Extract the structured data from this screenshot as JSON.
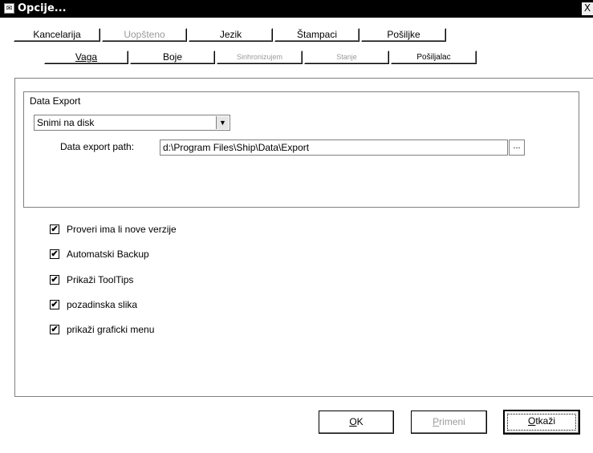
{
  "window": {
    "title": "Opcije...",
    "close_glyph": "X",
    "app_icon": "app-icon"
  },
  "tabs_row1": [
    {
      "label": "Kancelarija",
      "enabled": true
    },
    {
      "label": "Uopšteno",
      "enabled": false
    },
    {
      "label": "Jezik",
      "enabled": true
    },
    {
      "label": "Štampaci",
      "enabled": true
    },
    {
      "label": "Pošiljke",
      "enabled": true
    }
  ],
  "tabs_row2": [
    {
      "label": "Vaga",
      "enabled": true
    },
    {
      "label": "Boje",
      "enabled": true
    },
    {
      "label": "Sinhronizujem",
      "enabled": false
    },
    {
      "label": "Stanje",
      "enabled": false
    },
    {
      "label": "Pošiljalac",
      "enabled": true
    }
  ],
  "data_export": {
    "group_title": "Data Export",
    "mode_selected": "Snimi na disk",
    "path_label": "Data export path:",
    "path_value": "d:\\Program Files\\Ship\\Data\\Export",
    "browse_label": "..."
  },
  "options": [
    {
      "label": "Proveri ima li nove verzije",
      "checked": true
    },
    {
      "label": "Automatski Backup",
      "checked": true
    },
    {
      "label": "Prikaži ToolTips",
      "checked": true
    },
    {
      "label": "pozadinska slika",
      "checked": true
    },
    {
      "label": "prikaži graficki menu",
      "checked": true
    }
  ],
  "buttons": {
    "ok": {
      "mnemonic": "O",
      "rest": "K",
      "enabled": true
    },
    "apply": {
      "mnemonic": "P",
      "rest": "rimeni",
      "enabled": false
    },
    "cancel": {
      "mnemonic": "O",
      "rest": "tkaži",
      "enabled": true
    }
  },
  "check_glyph": "✔"
}
